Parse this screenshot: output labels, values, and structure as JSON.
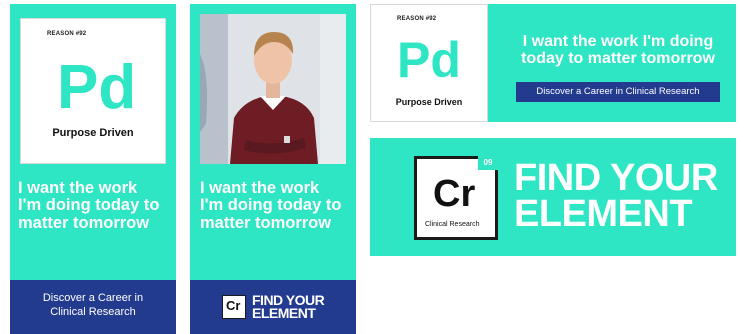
{
  "colors": {
    "teal": "#2ee6c4",
    "navy": "#233b8e",
    "white": "#ffffff"
  },
  "reason_label": "REASON #92",
  "element_purpose": {
    "symbol": "Pd",
    "name": "Purpose Driven"
  },
  "headline": "I want the work I'm doing today to matter tomorrow",
  "headline_lines": [
    "I want the work",
    "I'm doing today to",
    "matter tomorrow"
  ],
  "headline_lines_wide": [
    "I want the work I'm doing",
    "today to matter tomorrow"
  ],
  "cta": "Discover a Career in Clinical Research",
  "cta_lines": [
    "Discover a Career in",
    "Clinical Research"
  ],
  "element_clinical": {
    "symbol": "Cr",
    "name": "Clinical Research",
    "number": "09"
  },
  "tagline_lines": [
    "FIND YOUR",
    "ELEMENT"
  ],
  "icons": {
    "portrait": "man-portrait-photo"
  }
}
